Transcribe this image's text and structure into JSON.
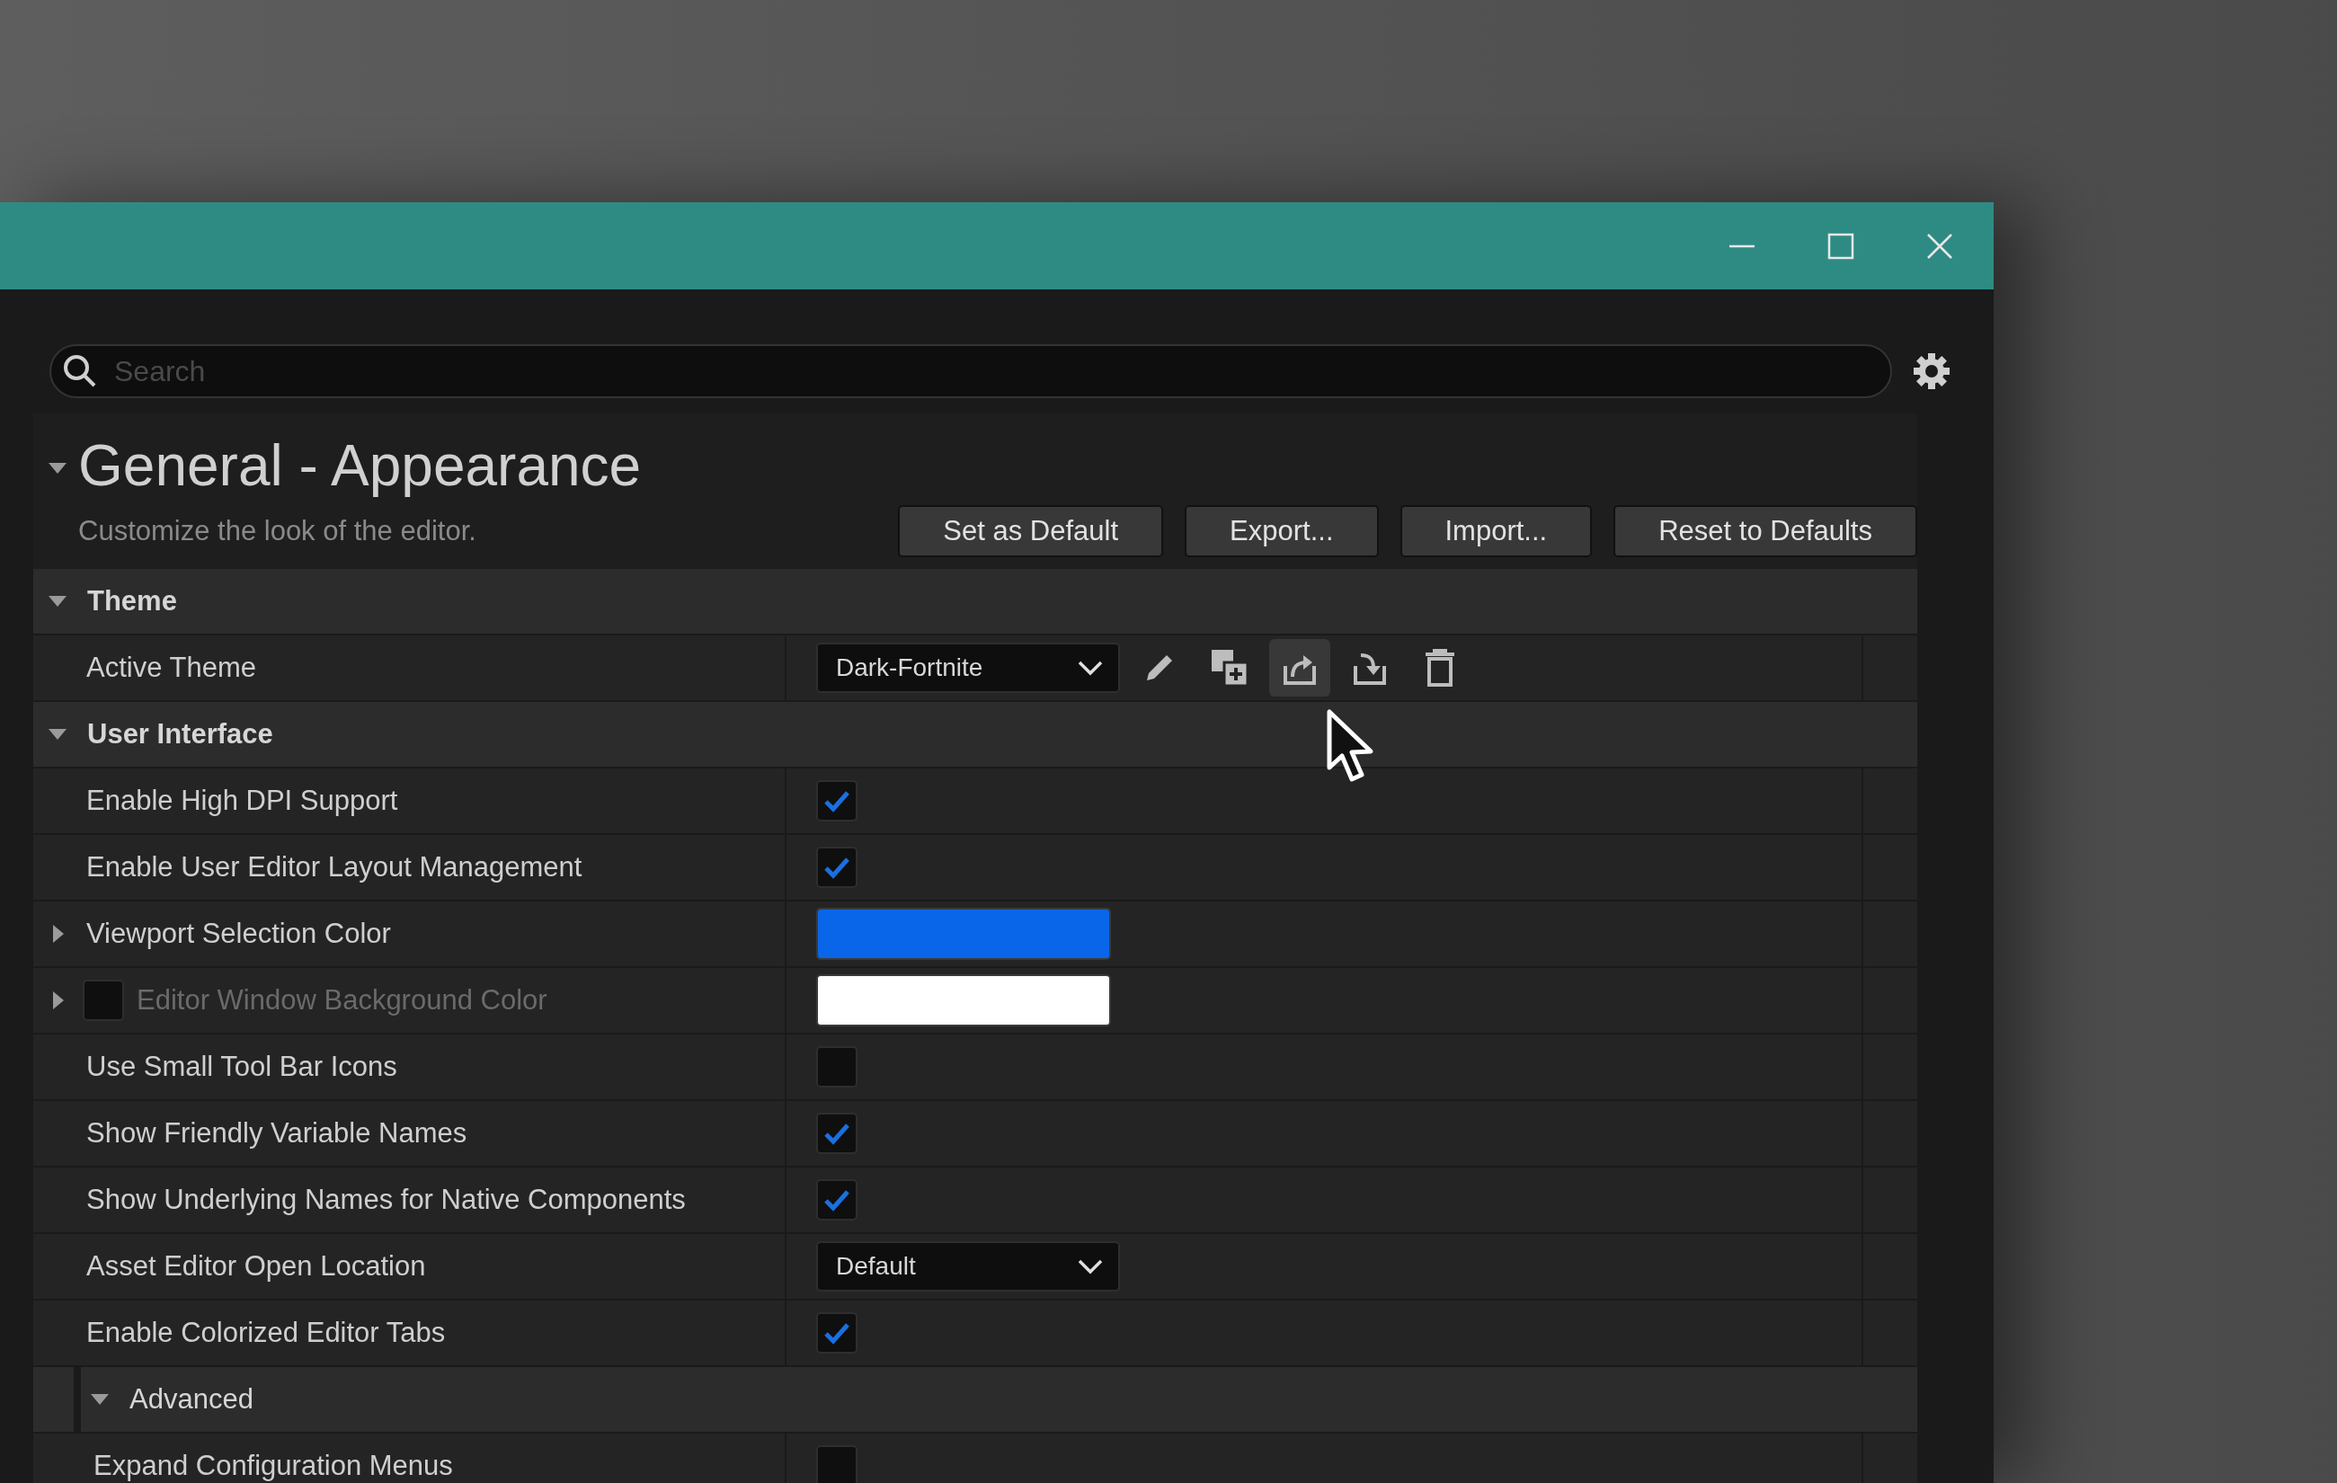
{
  "search": {
    "placeholder": "Search"
  },
  "header": {
    "title": "General - Appearance",
    "expanded": true,
    "description": "Customize the look of the editor.",
    "buttons": [
      "Set as Default",
      "Export...",
      "Import...",
      "Reset to Defaults"
    ]
  },
  "sections": [
    {
      "title": "Theme",
      "expanded": true,
      "rows": [
        {
          "kind": "theme",
          "label": "Active Theme",
          "value": "Dark-Fortnite",
          "actions": [
            {
              "kind": "edit",
              "hovered": false
            },
            {
              "kind": "duplicate",
              "hovered": false
            },
            {
              "kind": "export",
              "hovered": true
            },
            {
              "kind": "import",
              "hovered": false
            },
            {
              "kind": "delete",
              "hovered": false
            }
          ]
        }
      ]
    },
    {
      "title": "User Interface",
      "expanded": true,
      "rows": [
        {
          "kind": "checkbox",
          "label": "Enable High DPI Support",
          "checked": true
        },
        {
          "kind": "checkbox",
          "label": "Enable User Editor Layout Management",
          "checked": true
        },
        {
          "kind": "color",
          "label": "Viewport Selection Color",
          "expanded": false,
          "color": "#0a66e8"
        },
        {
          "kind": "color",
          "label": "Editor Window Background Color",
          "expanded": false,
          "disabled": true,
          "override": {
            "checked": false
          },
          "color": "#ffffff"
        },
        {
          "kind": "checkbox",
          "label": "Use Small Tool Bar Icons",
          "checked": false
        },
        {
          "kind": "checkbox",
          "label": "Show Friendly Variable Names",
          "checked": true
        },
        {
          "kind": "checkbox",
          "label": "Show Underlying Names for Native Components",
          "checked": true
        },
        {
          "kind": "dropdown",
          "label": "Asset Editor Open Location",
          "value": "Default"
        },
        {
          "kind": "checkbox",
          "label": "Enable Colorized Editor Tabs",
          "checked": true
        }
      ],
      "subsections": [
        {
          "title": "Advanced",
          "expanded": true,
          "rows": [
            {
              "kind": "checkbox",
              "label": "Expand Configuration Menus",
              "checked": false
            }
          ]
        }
      ]
    }
  ]
}
